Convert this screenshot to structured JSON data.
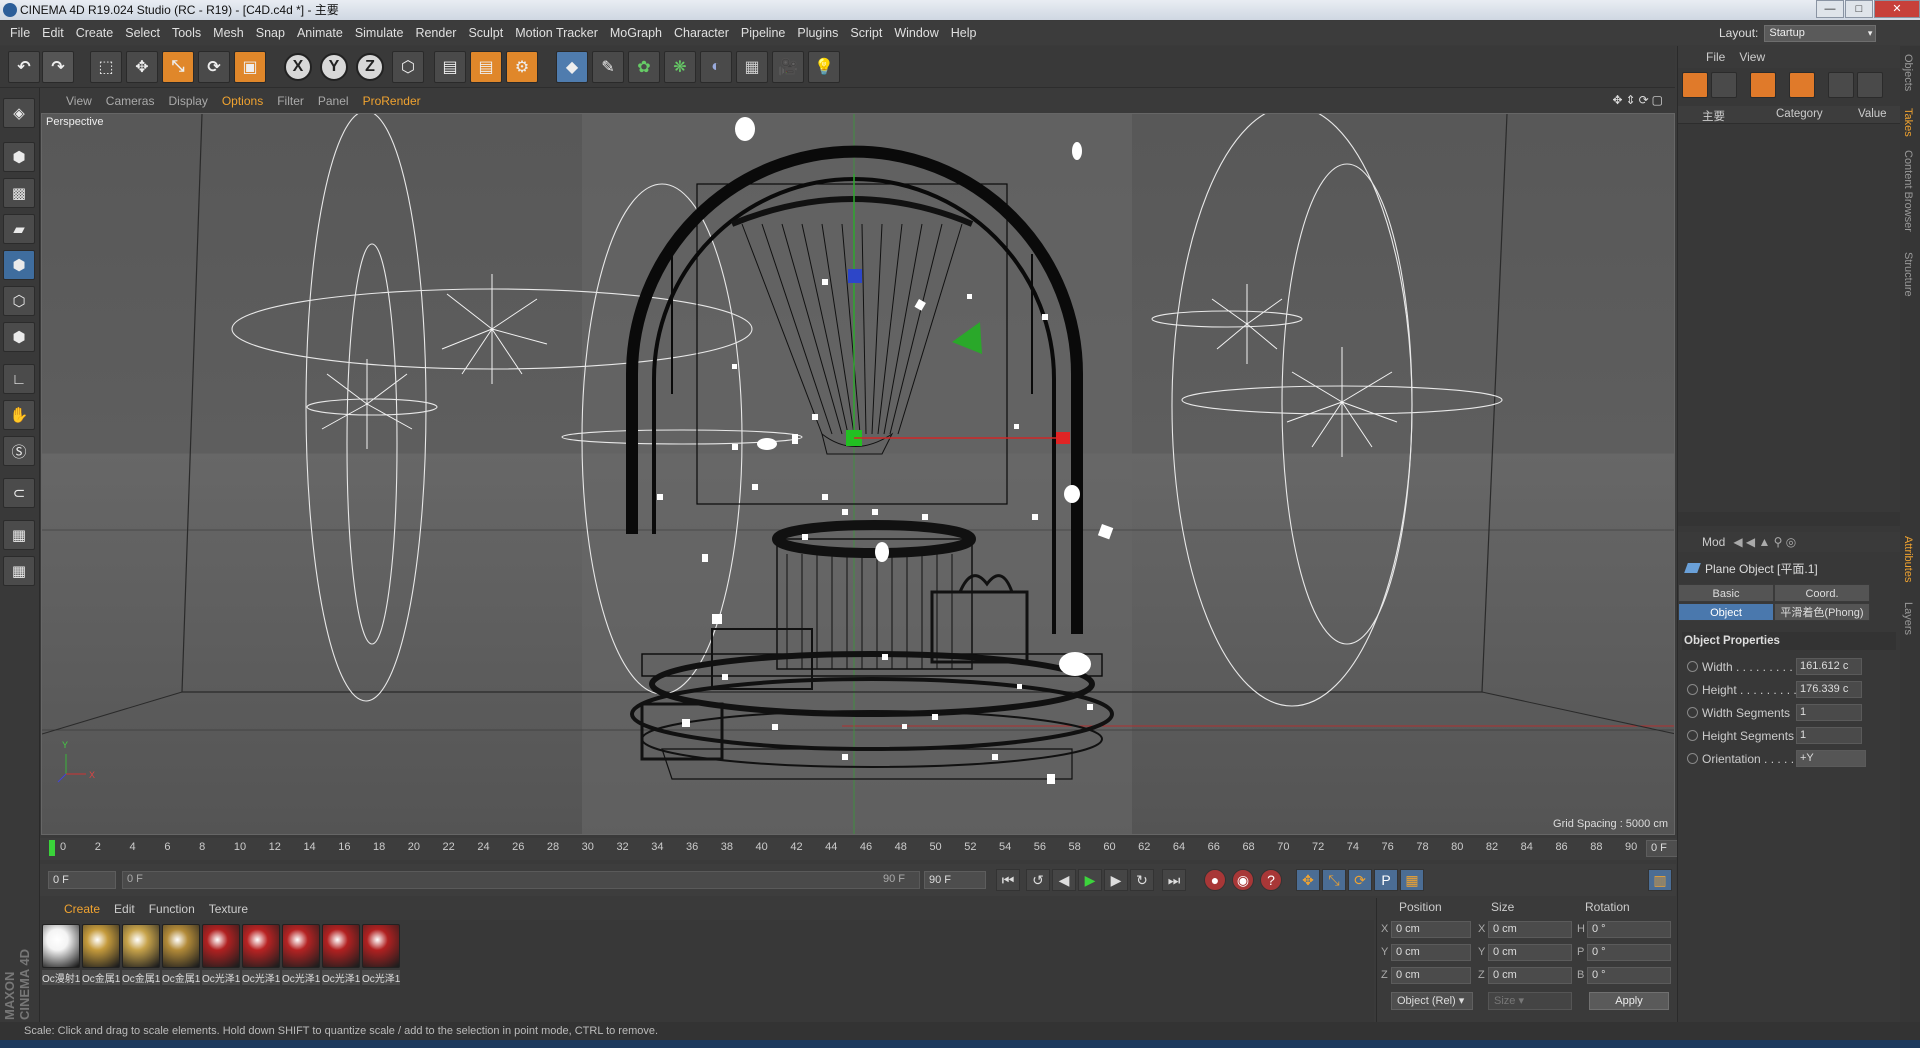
{
  "window": {
    "title": "CINEMA 4D R19.024 Studio (RC - R19) - [C4D.c4d *] - 主要",
    "controls": [
      "—",
      "□",
      "✕"
    ]
  },
  "menu": [
    "File",
    "Edit",
    "Create",
    "Select",
    "Tools",
    "Mesh",
    "Snap",
    "Animate",
    "Simulate",
    "Render",
    "Sculpt",
    "Motion Tracker",
    "MoGraph",
    "Character",
    "Pipeline",
    "Plugins",
    "Script",
    "Window",
    "Help"
  ],
  "layout": {
    "label": "Layout:",
    "value": "Startup"
  },
  "viewport": {
    "menu": [
      "View",
      "Cameras",
      "Display",
      "Options",
      "Filter",
      "Panel",
      "ProRender"
    ],
    "label": "Perspective",
    "grid": "Grid Spacing : 5000 cm"
  },
  "timeline": {
    "ticks": [
      "0",
      "2",
      "4",
      "6",
      "8",
      "10",
      "12",
      "14",
      "16",
      "18",
      "20",
      "22",
      "24",
      "26",
      "28",
      "30",
      "32",
      "34",
      "36",
      "38",
      "40",
      "42",
      "44",
      "46",
      "48",
      "50",
      "52",
      "54",
      "56",
      "58",
      "60",
      "62",
      "64",
      "66",
      "68",
      "70",
      "72",
      "74",
      "76",
      "78",
      "80",
      "82",
      "84",
      "86",
      "88",
      "90"
    ],
    "current": "0 F",
    "start": "0 F",
    "slider_start": "0 F",
    "slider_end": "90 F",
    "end": "90 F"
  },
  "materials": {
    "menu": [
      "Create",
      "Edit",
      "Function",
      "Texture"
    ],
    "items": [
      {
        "label": "Oc漫射1",
        "color": "#f4f4f4"
      },
      {
        "label": "Oc金属1",
        "color": "#c49a3c"
      },
      {
        "label": "Oc金属1",
        "color": "#c6a24a"
      },
      {
        "label": "Oc金属1",
        "color": "#b28a38"
      },
      {
        "label": "Oc光泽1",
        "color": "#b02020"
      },
      {
        "label": "Oc光泽1",
        "color": "#b82222"
      },
      {
        "label": "Oc光泽1",
        "color": "#b42222"
      },
      {
        "label": "Oc光泽1",
        "color": "#b22020"
      },
      {
        "label": "Oc光泽1",
        "color": "#b02020"
      }
    ]
  },
  "coords": {
    "headers": [
      "Position",
      "Size",
      "Rotation"
    ],
    "rows": [
      {
        "axis": "X",
        "pos": "0 cm",
        "saxis": "X",
        "size": "0 cm",
        "raxis": "H",
        "rot": "0 °"
      },
      {
        "axis": "Y",
        "pos": "0 cm",
        "saxis": "Y",
        "size": "0 cm",
        "raxis": "P",
        "rot": "0 °"
      },
      {
        "axis": "Z",
        "pos": "0 cm",
        "saxis": "Z",
        "size": "0 cm",
        "raxis": "B",
        "rot": "0 °"
      }
    ],
    "mode": "Object (Rel)",
    "size_mode": "Size",
    "apply": "Apply"
  },
  "status": "Scale: Click and drag to scale elements. Hold down SHIFT to quantize scale / add to the selection in point mode, CTRL to remove.",
  "objects": {
    "menu": [
      "File",
      "View"
    ],
    "columns": {
      "name": "主要",
      "category": "Category",
      "value": "Value"
    }
  },
  "attributes": {
    "menu": [
      "Mod"
    ],
    "title": "Plane Object [平面.1]",
    "tabs": [
      "Basic",
      "Coord.",
      "Object",
      "平滑着色(Phong)"
    ],
    "section": "Object Properties",
    "props": [
      {
        "name": "Width . . . . . . . . . .",
        "value": "161.612 c"
      },
      {
        "name": "Height . . . . . . . . . .",
        "value": "176.339 c"
      },
      {
        "name": "Width Segments",
        "value": "1"
      },
      {
        "name": "Height Segments",
        "value": "1"
      },
      {
        "name": "Orientation . . . . .",
        "value": "+Y"
      }
    ]
  },
  "side_tabs": [
    "Objects",
    "Takes",
    "Content Browser",
    "Structure",
    "Attributes",
    "Layers"
  ]
}
